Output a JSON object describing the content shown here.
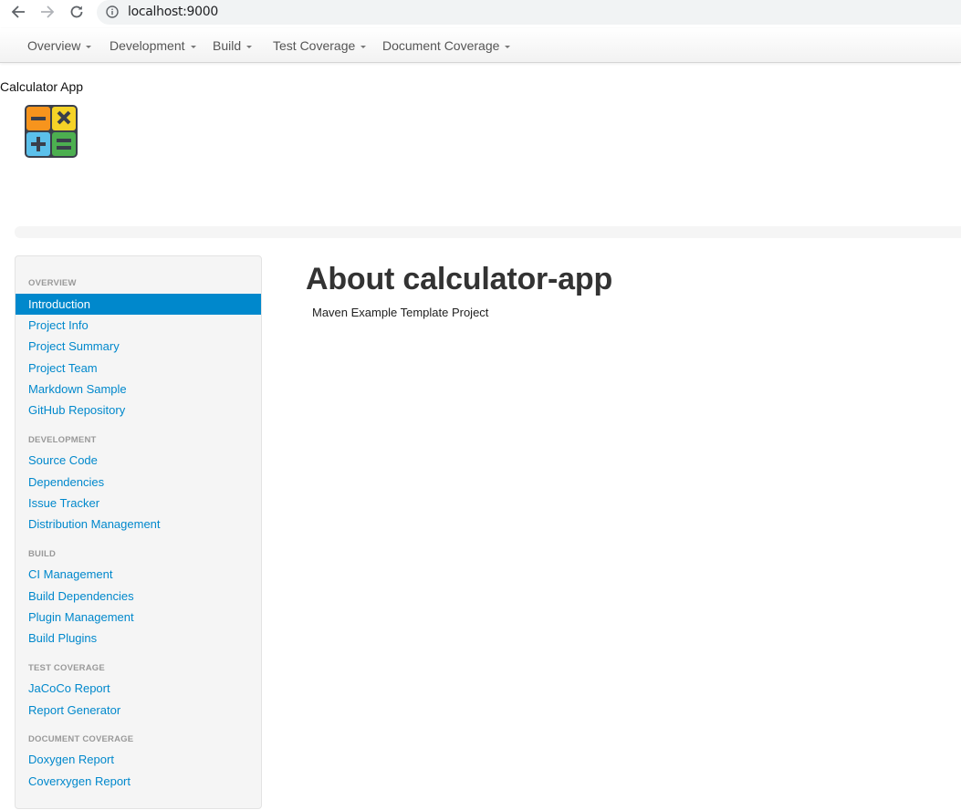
{
  "browser": {
    "url": "localhost:9000",
    "icons": [
      "back-arrow-icon",
      "forward-arrow-icon",
      "reload-icon",
      "info-icon"
    ]
  },
  "navbar": {
    "menus": [
      {
        "label": "Overview"
      },
      {
        "label": "Development"
      },
      {
        "label": "Build"
      },
      {
        "label": "Test Coverage"
      },
      {
        "label": "Document Coverage"
      }
    ]
  },
  "banner": {
    "title": "Calculator App",
    "logo": "calculator-logo-icon"
  },
  "sidebar": {
    "sections": [
      {
        "header": "OVERVIEW",
        "items": [
          {
            "label": "Introduction",
            "active": true
          },
          {
            "label": "Project Info"
          },
          {
            "label": "Project Summary"
          },
          {
            "label": "Project Team"
          },
          {
            "label": "Markdown Sample"
          },
          {
            "label": "GitHub Repository"
          }
        ]
      },
      {
        "header": "DEVELOPMENT",
        "items": [
          {
            "label": "Source Code"
          },
          {
            "label": "Dependencies"
          },
          {
            "label": "Issue Tracker"
          },
          {
            "label": "Distribution Management"
          }
        ]
      },
      {
        "header": "BUILD",
        "items": [
          {
            "label": "CI Management"
          },
          {
            "label": "Build Dependencies"
          },
          {
            "label": "Plugin Management"
          },
          {
            "label": "Build Plugins"
          }
        ]
      },
      {
        "header": "TEST COVERAGE",
        "items": [
          {
            "label": "JaCoCo Report"
          },
          {
            "label": "Report Generator"
          }
        ]
      },
      {
        "header": "DOCUMENT COVERAGE",
        "items": [
          {
            "label": "Doxygen Report"
          },
          {
            "label": "Coverxygen Report"
          }
        ]
      }
    ]
  },
  "main": {
    "title": "About calculator-app",
    "description": "Maven Example Template Project"
  },
  "colors": {
    "link": "#0088cc",
    "active_bg": "#0088cc",
    "sidebar_bg": "#f5f5f5",
    "header_text": "#999999"
  }
}
